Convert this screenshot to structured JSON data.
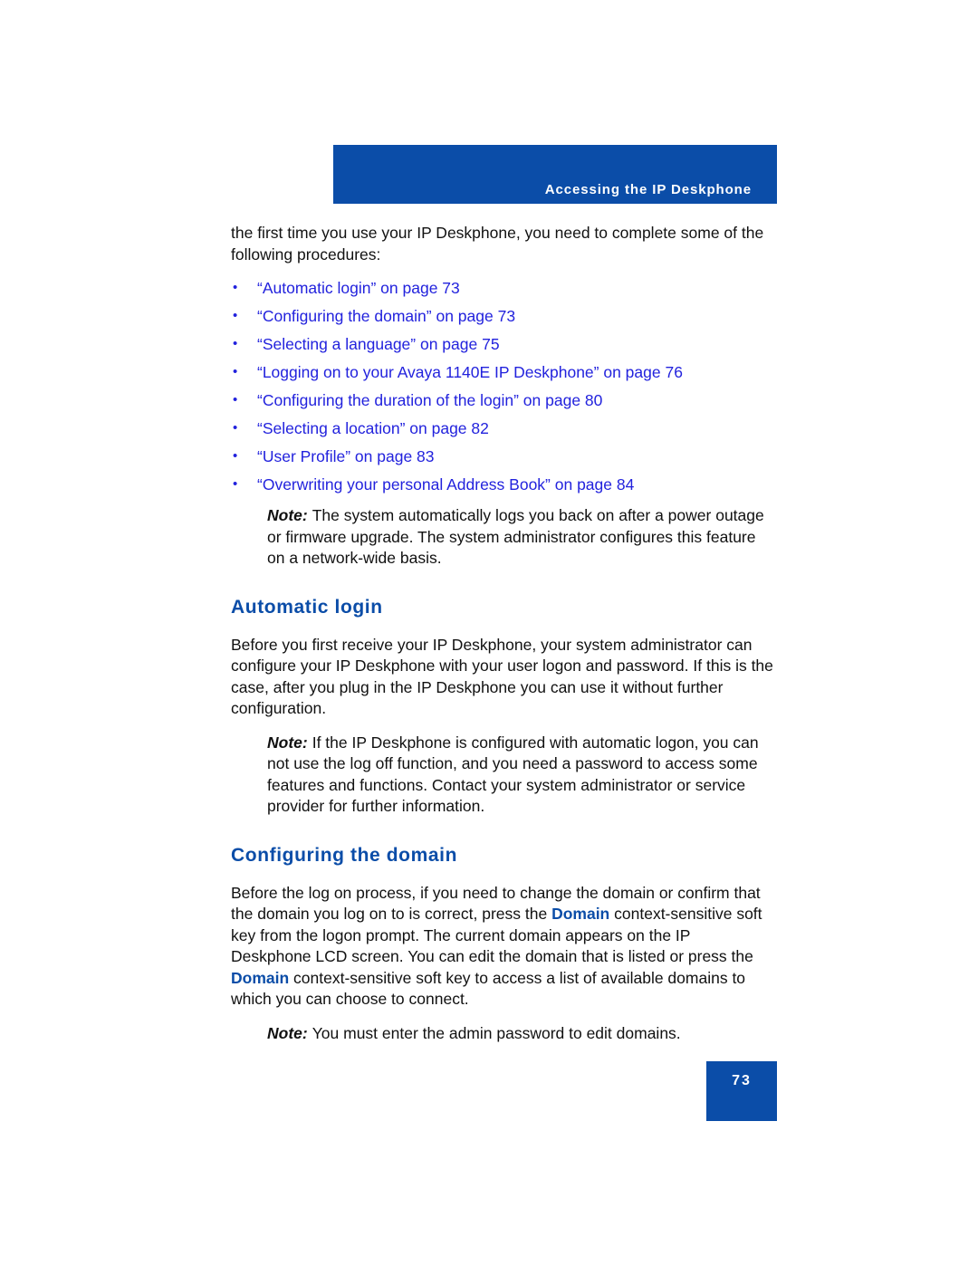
{
  "header": {
    "title": "Accessing the IP Deskphone"
  },
  "intro": {
    "paragraph": "the first time you use your IP Deskphone, you need to complete some of the following procedures:"
  },
  "link_list": {
    "bullet": "•",
    "items": [
      {
        "label": "“Automatic login” on page 73"
      },
      {
        "label": "“Configuring the domain” on page 73"
      },
      {
        "label": "“Selecting a language” on page 75"
      },
      {
        "label": "“Logging on to your Avaya 1140E IP Deskphone” on page 76"
      },
      {
        "label": "“Configuring the duration of the login” on page 80"
      },
      {
        "label": "“Selecting a location” on page 82"
      },
      {
        "label": "“User Profile” on page 83"
      },
      {
        "label": "“Overwriting your personal Address Book” on page 84"
      }
    ]
  },
  "note_one": {
    "label": "Note:",
    "text": "The system automatically logs you back on after a power outage or firmware upgrade. The system administrator configures this feature on a network-wide basis."
  },
  "automatic_login": {
    "heading": "Automatic login",
    "paragraph": "Before you first receive your IP Deskphone, your system administrator can configure your IP Deskphone with your user logon and password. If this is the case, after you plug in the IP Deskphone you can use it without further configuration."
  },
  "note_two": {
    "label": "Note:",
    "text": "If the IP Deskphone is configured with automatic logon, you can not use the log off function, and you need a password to access some features and functions. Contact your system administrator or service provider for further information."
  },
  "configuring_domain": {
    "heading": "Configuring the domain",
    "paragraph_part1": "Before the log on process, if you need to change the domain or confirm that the domain you log on to is correct, press the ",
    "key1": "Domain",
    "paragraph_part2": " context-sensitive soft key from the logon prompt. The current domain appears on the IP Deskphone LCD screen. You can edit the domain that is listed or press the ",
    "key2": "Domain",
    "paragraph_part3": " context-sensitive soft key to access a list of available domains to which you can choose to connect."
  },
  "note_three": {
    "label": "Note:",
    "text": "You must enter the admin password to edit domains."
  },
  "footer": {
    "page_number": "73"
  },
  "colors": {
    "brand_blue": "#0B4DA8",
    "link_blue": "#2222DD",
    "text_black": "#111111",
    "page_white": "#FFFFFF"
  }
}
